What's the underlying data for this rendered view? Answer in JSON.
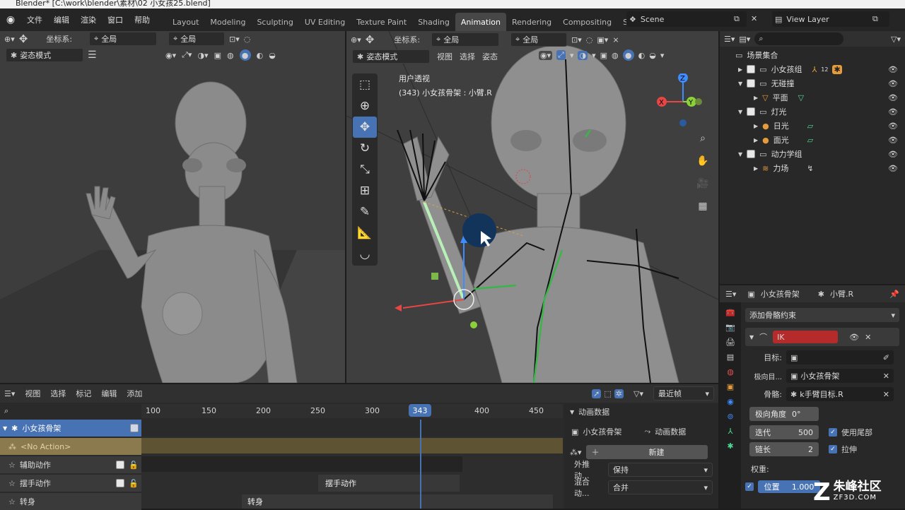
{
  "title": "Blender* [C:\\work\\blender\\素材\\02 小女孩25.blend]",
  "menu": [
    "文件",
    "编辑",
    "渲染",
    "窗口",
    "帮助"
  ],
  "workspaces": [
    {
      "label": "Layout",
      "active": false
    },
    {
      "label": "Modeling",
      "active": false
    },
    {
      "label": "Sculpting",
      "active": false
    },
    {
      "label": "UV Editing",
      "active": false
    },
    {
      "label": "Texture Paint",
      "active": false
    },
    {
      "label": "Shading",
      "active": false
    },
    {
      "label": "Animation",
      "active": true
    },
    {
      "label": "Rendering",
      "active": false
    },
    {
      "label": "Compositing",
      "active": false
    },
    {
      "label": "Sc",
      "active": false
    }
  ],
  "scene_name": "Scene",
  "view_layer": "View Layer",
  "left_view": {
    "coord_label": "坐标系:",
    "coord_value": "全局",
    "pivot_value": "全局",
    "mode": "姿态模式"
  },
  "main_view": {
    "coord_label": "坐标系:",
    "coord_value": "全局",
    "pivot_value": "全局",
    "mode": "姿态模式",
    "menus": [
      "视图",
      "选择",
      "姿态"
    ],
    "overlay_line1": "用户透视",
    "overlay_line2": "(343) 小女孩骨架 : 小臂.R"
  },
  "outliner": {
    "search_placeholder": "",
    "root": "场景集合",
    "items": [
      {
        "label": "小女孩组",
        "level": 1,
        "expanded": false,
        "badge": "12"
      },
      {
        "label": "无碰撞",
        "level": 1,
        "expanded": true
      },
      {
        "label": "平面",
        "level": 2
      },
      {
        "label": "灯光",
        "level": 1,
        "expanded": true
      },
      {
        "label": "日光",
        "level": 2
      },
      {
        "label": "面光",
        "level": 2
      },
      {
        "label": "动力学组",
        "level": 1,
        "expanded": true
      },
      {
        "label": "力场",
        "level": 2
      }
    ]
  },
  "properties": {
    "object_name": "小女孩骨架",
    "bone_name": "小臂.R",
    "add_constraint": "添加骨骼约束",
    "constraint_name": "IK",
    "target_label": "目标:",
    "target_value": "",
    "pole_label": "极向目...",
    "pole_value": "小女孩骨架",
    "bone_label": "骨骼:",
    "bone_value": "k手臂目标.R",
    "pole_angle": "极向角度",
    "pole_angle_value": "0°",
    "iterations_label": "迭代",
    "iterations_value": "500",
    "use_tail": "使用尾部",
    "chain_label": "链长",
    "chain_value": "2",
    "stretch": "拉伸",
    "weight_label": "权重:",
    "position_label": "位置",
    "position_value": "1.000"
  },
  "dopesheet": {
    "menus": [
      "视图",
      "选择",
      "标记",
      "编辑",
      "添加"
    ],
    "snap_mode": "最近帧",
    "ticks": [
      "100",
      "150",
      "200",
      "250",
      "300",
      "400",
      "450"
    ],
    "current_frame": "343",
    "channels": [
      {
        "label": "小女孩骨架",
        "type": "armature"
      },
      {
        "label": "<No Action>",
        "type": "action"
      },
      {
        "label": "辅助动作",
        "type": "strip"
      },
      {
        "label": "摆手动作",
        "type": "strip"
      },
      {
        "label": "转身",
        "type": "strip"
      }
    ],
    "strip_label": "摆手动作",
    "strip_label2": "转身"
  },
  "anim_data": {
    "header": "动画数据",
    "object": "小女孩骨架",
    "anim_data_label": "动画数据",
    "new_button": "新建",
    "extrapolation_label": "外推动...",
    "extrapolation_value": "保持",
    "blend_label": "混合动...",
    "blend_value": "合并"
  },
  "watermark": {
    "brand": "朱峰社区",
    "url": "ZF3D.COM"
  }
}
